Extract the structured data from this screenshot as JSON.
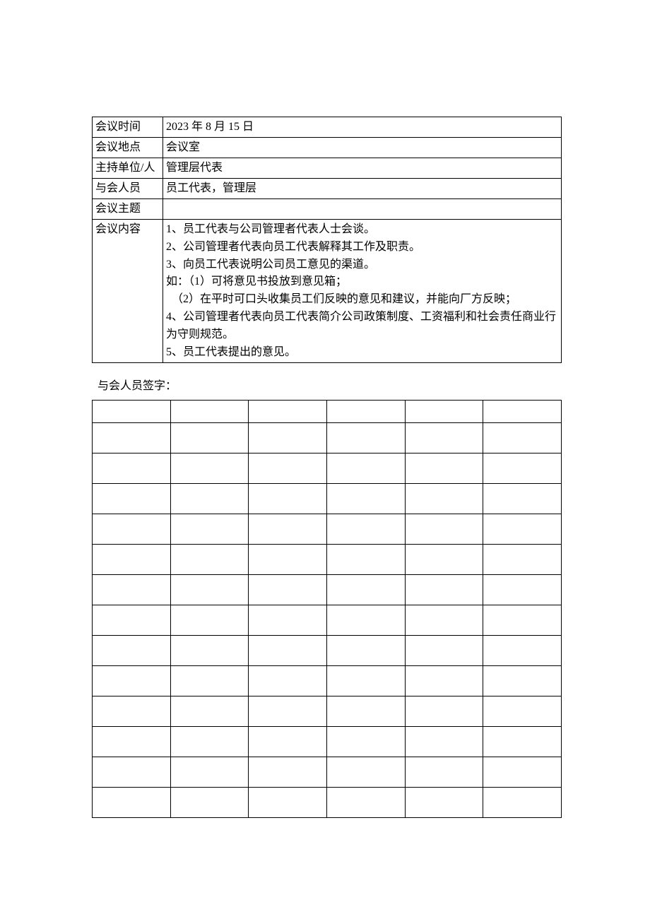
{
  "meeting": {
    "rows": [
      {
        "label": "会议时间",
        "value": "2023 年 8 月 15 日"
      },
      {
        "label": "会议地点",
        "value": "会议室"
      },
      {
        "label": "主持单位/人",
        "value": "管理层代表"
      },
      {
        "label": "与会人员",
        "value": "员工代表，管理层"
      },
      {
        "label": "会议主题",
        "value": ""
      }
    ],
    "content_label": "会议内容",
    "content_lines": [
      "1、员工代表与公司管理者代表人士会谈。",
      "2、公司管理者代表向员工代表解释其工作及职责。",
      "3、向员工代表说明公司员工意见的渠道。",
      "如：（1）可将意见书投放到意见箱；",
      "　（2）在平时可口头收集员工们反映的意见和建议，并能向厂方反映；",
      "4、公司管理者代表向员工代表简介公司政策制度、工资福利和社会责任商业行为守则规范。",
      "5、员工代表提出的意见。"
    ]
  },
  "signature": {
    "label": "与会人员签字：",
    "rows": 14,
    "cols": 6
  }
}
